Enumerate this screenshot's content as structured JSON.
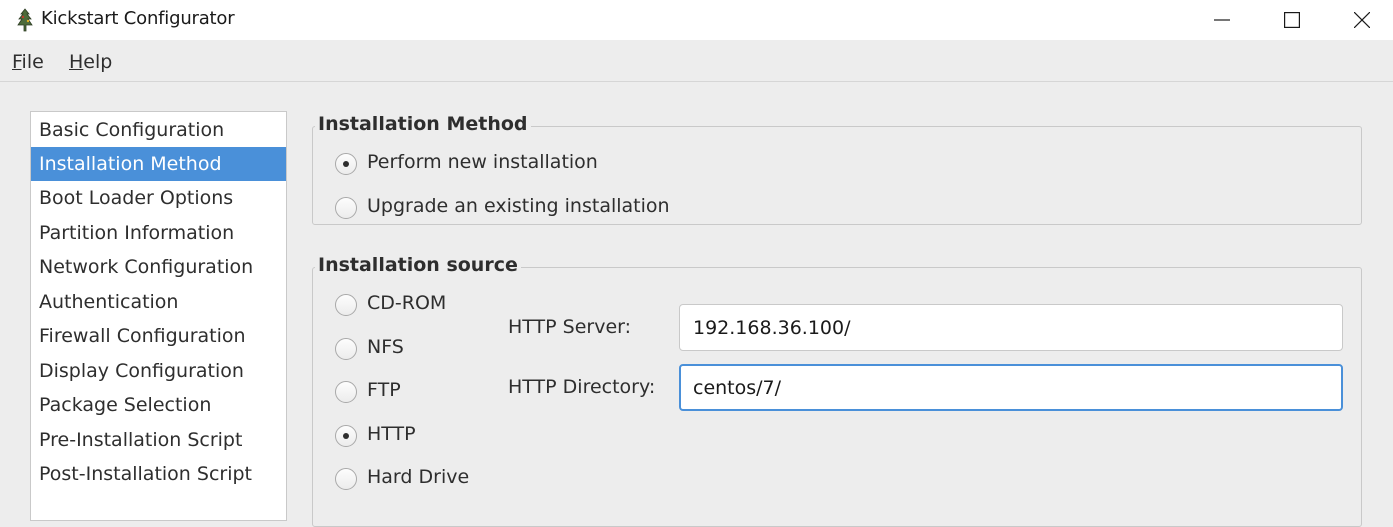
{
  "window": {
    "title": "Kickstart Configurator",
    "app_icon": "kickstart-app-icon",
    "controls": [
      "minimize-icon",
      "maximize-icon",
      "close-icon"
    ]
  },
  "menu": {
    "file": {
      "mnemonic": "F",
      "rest": "ile"
    },
    "help": {
      "mnemonic": "H",
      "rest": "elp"
    }
  },
  "sidebar": {
    "selected_index": 1,
    "items": [
      "Basic Configuration",
      "Installation Method",
      "Boot Loader Options",
      "Partition Information",
      "Network Configuration",
      "Authentication",
      "Firewall Configuration",
      "Display Configuration",
      "Package Selection",
      "Pre-Installation Script",
      "Post-Installation Script"
    ]
  },
  "installation_method": {
    "title": "Installation Method",
    "options": [
      {
        "label": "Perform new installation",
        "selected": true
      },
      {
        "label": "Upgrade an existing installation",
        "selected": false
      }
    ]
  },
  "installation_source": {
    "title": "Installation source",
    "options": [
      {
        "label": "CD-ROM",
        "selected": false
      },
      {
        "label": "NFS",
        "selected": false
      },
      {
        "label": "FTP",
        "selected": false
      },
      {
        "label": "HTTP",
        "selected": true
      },
      {
        "label": "Hard Drive",
        "selected": false
      }
    ],
    "http_server": {
      "label": "HTTP Server:",
      "value": "192.168.36.100/"
    },
    "http_directory": {
      "label": "HTTP Directory:",
      "value": "centos/7/"
    }
  },
  "colors": {
    "accent": "#4a90d9",
    "background": "#ededed",
    "titlebar": "#ffffff"
  }
}
